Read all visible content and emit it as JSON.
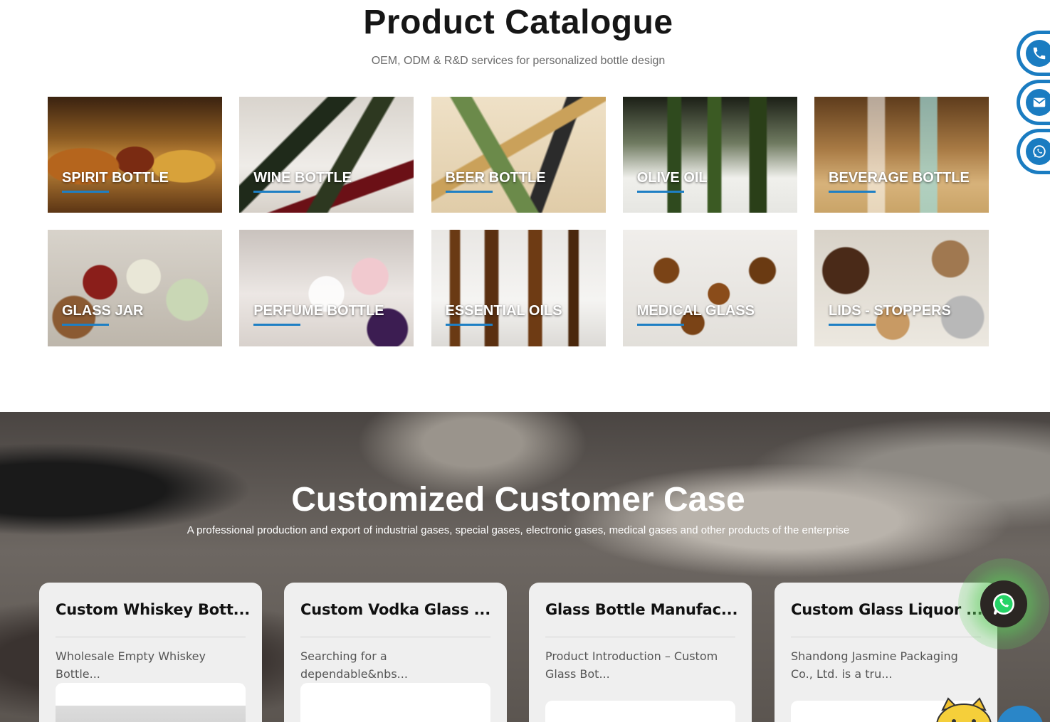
{
  "catalogue": {
    "title": "Product Catalogue",
    "subtitle": "OEM, ODM & R&D services for personalized bottle design",
    "items": [
      {
        "label": "SPIRIT BOTTLE"
      },
      {
        "label": "WINE BOTTLE"
      },
      {
        "label": "BEER BOTTLE"
      },
      {
        "label": "OLIVE OIL"
      },
      {
        "label": "BEVERAGE BOTTLE"
      },
      {
        "label": "GLASS JAR"
      },
      {
        "label": "PERFUME BOTTLE"
      },
      {
        "label": "ESSENTIAL OILS"
      },
      {
        "label": "MEDICAL GLASS"
      },
      {
        "label": "LIDS - STOPPERS"
      }
    ]
  },
  "cases": {
    "title": "Customized Customer Case",
    "subtitle": "A professional production and export of industrial gases, special gases, electronic gases, medical gases and other products of the enterprise",
    "items": [
      {
        "title": "Custom Whiskey Bott...",
        "description": "Wholesale Empty Whiskey Bottle..."
      },
      {
        "title": "Custom Vodka Glass ...",
        "description": "Searching for a dependable&nbs..."
      },
      {
        "title": "Glass Bottle Manufac...",
        "description": "Product Introduction – Custom Glass Bot..."
      },
      {
        "title": "Custom Glass Liquor ...",
        "description": "Shandong Jasmine Packaging Co., Ltd. is a tru..."
      }
    ]
  },
  "floating": {
    "icons": [
      "phone-icon",
      "email-icon",
      "whatsapp-icon"
    ],
    "accent_color": "#1a7cc1",
    "whatsapp_color": "#5ccd5a"
  }
}
